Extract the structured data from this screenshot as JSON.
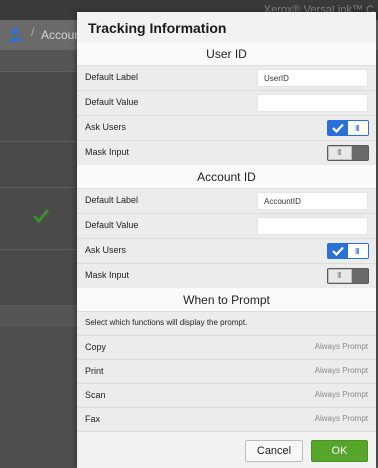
{
  "background": {
    "brand": "Xerox® VersaLink™ C",
    "breadcrumb": "Account",
    "separator": "/",
    "user_icon": "user-icon",
    "check_icon": "checkmark-icon"
  },
  "dialog": {
    "title": "Tracking Information",
    "user_id": {
      "heading": "User ID",
      "default_label": {
        "label": "Default Label",
        "value": "UserID"
      },
      "default_value": {
        "label": "Default Value",
        "value": ""
      },
      "ask_users": {
        "label": "Ask Users",
        "state": "on"
      },
      "mask_input": {
        "label": "Mask Input",
        "state": "off"
      }
    },
    "account_id": {
      "heading": "Account ID",
      "default_label": {
        "label": "Default Label",
        "value": "AccountID"
      },
      "default_value": {
        "label": "Default Value",
        "value": ""
      },
      "ask_users": {
        "label": "Ask Users",
        "state": "on"
      },
      "mask_input": {
        "label": "Mask Input",
        "state": "off"
      }
    },
    "when_to_prompt": {
      "heading": "When to Prompt",
      "description": "Select which functions will display the prompt.",
      "items": [
        {
          "label": "Copy",
          "value": "Always Prompt"
        },
        {
          "label": "Print",
          "value": "Always Prompt"
        },
        {
          "label": "Scan",
          "value": "Always Prompt"
        },
        {
          "label": "Fax",
          "value": "Always Prompt"
        }
      ]
    },
    "buttons": {
      "cancel": "Cancel",
      "ok": "OK"
    }
  },
  "colors": {
    "toggle_on": "#2b6fd8",
    "ok_button": "#58a52b",
    "check": "#3d8f2e"
  }
}
